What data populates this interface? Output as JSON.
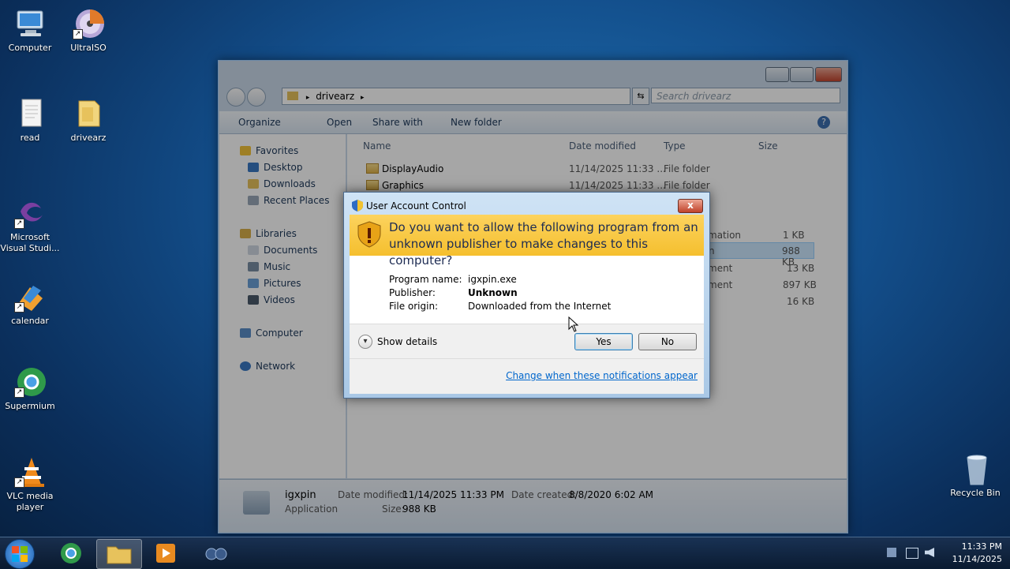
{
  "desktop": {
    "icons": [
      {
        "label": "Computer"
      },
      {
        "label": "UltraISO"
      },
      {
        "label": "read"
      },
      {
        "label": "drivearz"
      },
      {
        "label": "Microsoft Visual Studi..."
      },
      {
        "label": "calendar"
      },
      {
        "label": "Supermium"
      },
      {
        "label": "VLC media player"
      },
      {
        "label": "Recycle Bin"
      }
    ]
  },
  "explorer": {
    "address_segment": "drivearz",
    "search_placeholder": "Search drivearz",
    "toolbar": {
      "organize": "Organize",
      "open": "Open",
      "share_with": "Share with",
      "new_folder": "New folder"
    },
    "nav": {
      "favorites": "Favorites",
      "desktop": "Desktop",
      "downloads": "Downloads",
      "recent_places": "Recent Places",
      "libraries": "Libraries",
      "documents": "Documents",
      "music": "Music",
      "pictures": "Pictures",
      "videos": "Videos",
      "computer": "Computer",
      "network": "Network"
    },
    "columns": {
      "name": "Name",
      "date_modified": "Date modified",
      "type": "Type",
      "size": "Size"
    },
    "rows": [
      {
        "name": "DisplayAudio",
        "date": "11/14/2025 11:33 ...",
        "type": "File folder",
        "size": ""
      },
      {
        "name": "Graphics",
        "date": "11/14/2025 11:33 ...",
        "type": "File folder",
        "size": ""
      },
      {
        "name": "",
        "date": "",
        "type": "mation",
        "size": "1 KB"
      },
      {
        "name": "",
        "date": "",
        "type": "n",
        "size": "988 KB"
      },
      {
        "name": "",
        "date": "",
        "type": "ment",
        "size": "13 KB"
      },
      {
        "name": "",
        "date": "",
        "type": "ment",
        "size": "897 KB"
      },
      {
        "name": "",
        "date": "",
        "type": "",
        "size": "16 KB"
      }
    ],
    "details": {
      "name": "igxpin",
      "kind": "Application",
      "date_modified_label": "Date modified:",
      "date_modified": "11/14/2025 11:33 PM",
      "size_label": "Size:",
      "size": "988 KB",
      "date_created_label": "Date created:",
      "date_created": "8/8/2020 6:02 AM"
    }
  },
  "uac": {
    "title": "User Account Control",
    "close": "x",
    "question": "Do you want to allow the following program from an unknown publisher to make changes to this computer?",
    "program_name_label": "Program name:",
    "program_name": "igxpin.exe",
    "publisher_label": "Publisher:",
    "publisher": "Unknown",
    "file_origin_label": "File origin:",
    "file_origin": "Downloaded from the Internet",
    "show_details": "Show details",
    "yes": "Yes",
    "no": "No",
    "change_link": "Change when these notifications appear"
  },
  "taskbar": {
    "time": "11:33 PM",
    "date": "11/14/2025"
  }
}
